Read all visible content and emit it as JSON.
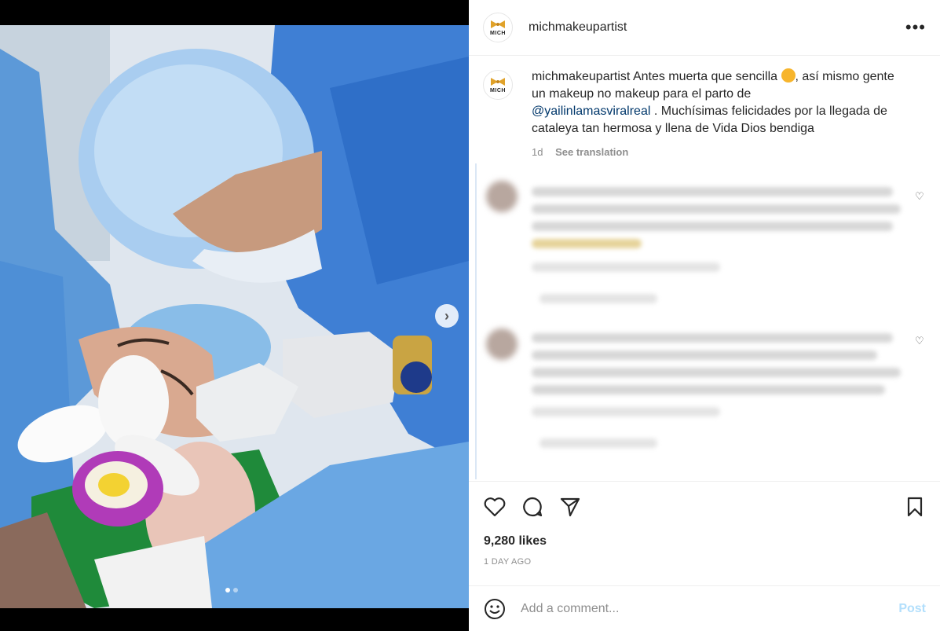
{
  "post": {
    "username": "michmakeupartist",
    "avatar_text": "MICH",
    "more_icon": "more-horizontal-icon",
    "caption": {
      "username": "michmakeupartist",
      "text_part1": "Antes muerta que sencilla",
      "text_part2": ", así mismo gente un makeup no makeup para el parto de",
      "mention": "@yailinlamasviralreal",
      "text_part3": " . Muchísimas felicidades por la llegada de cataleya tan hermosa y llena de Vida Dios bendiga",
      "age": "1d",
      "see_translation": "See translation"
    },
    "likes": "9,280 likes",
    "timestamp": "1 DAY AGO",
    "comment_placeholder": "Add a comment...",
    "post_label": "Post"
  },
  "colors": {
    "link": "#00376b",
    "post_button": "#b2dffc",
    "muted": "#8e8e8e",
    "brand_gold": "#e0a22a"
  },
  "media": {
    "carousel_dots": 2,
    "active_dot": 1
  }
}
